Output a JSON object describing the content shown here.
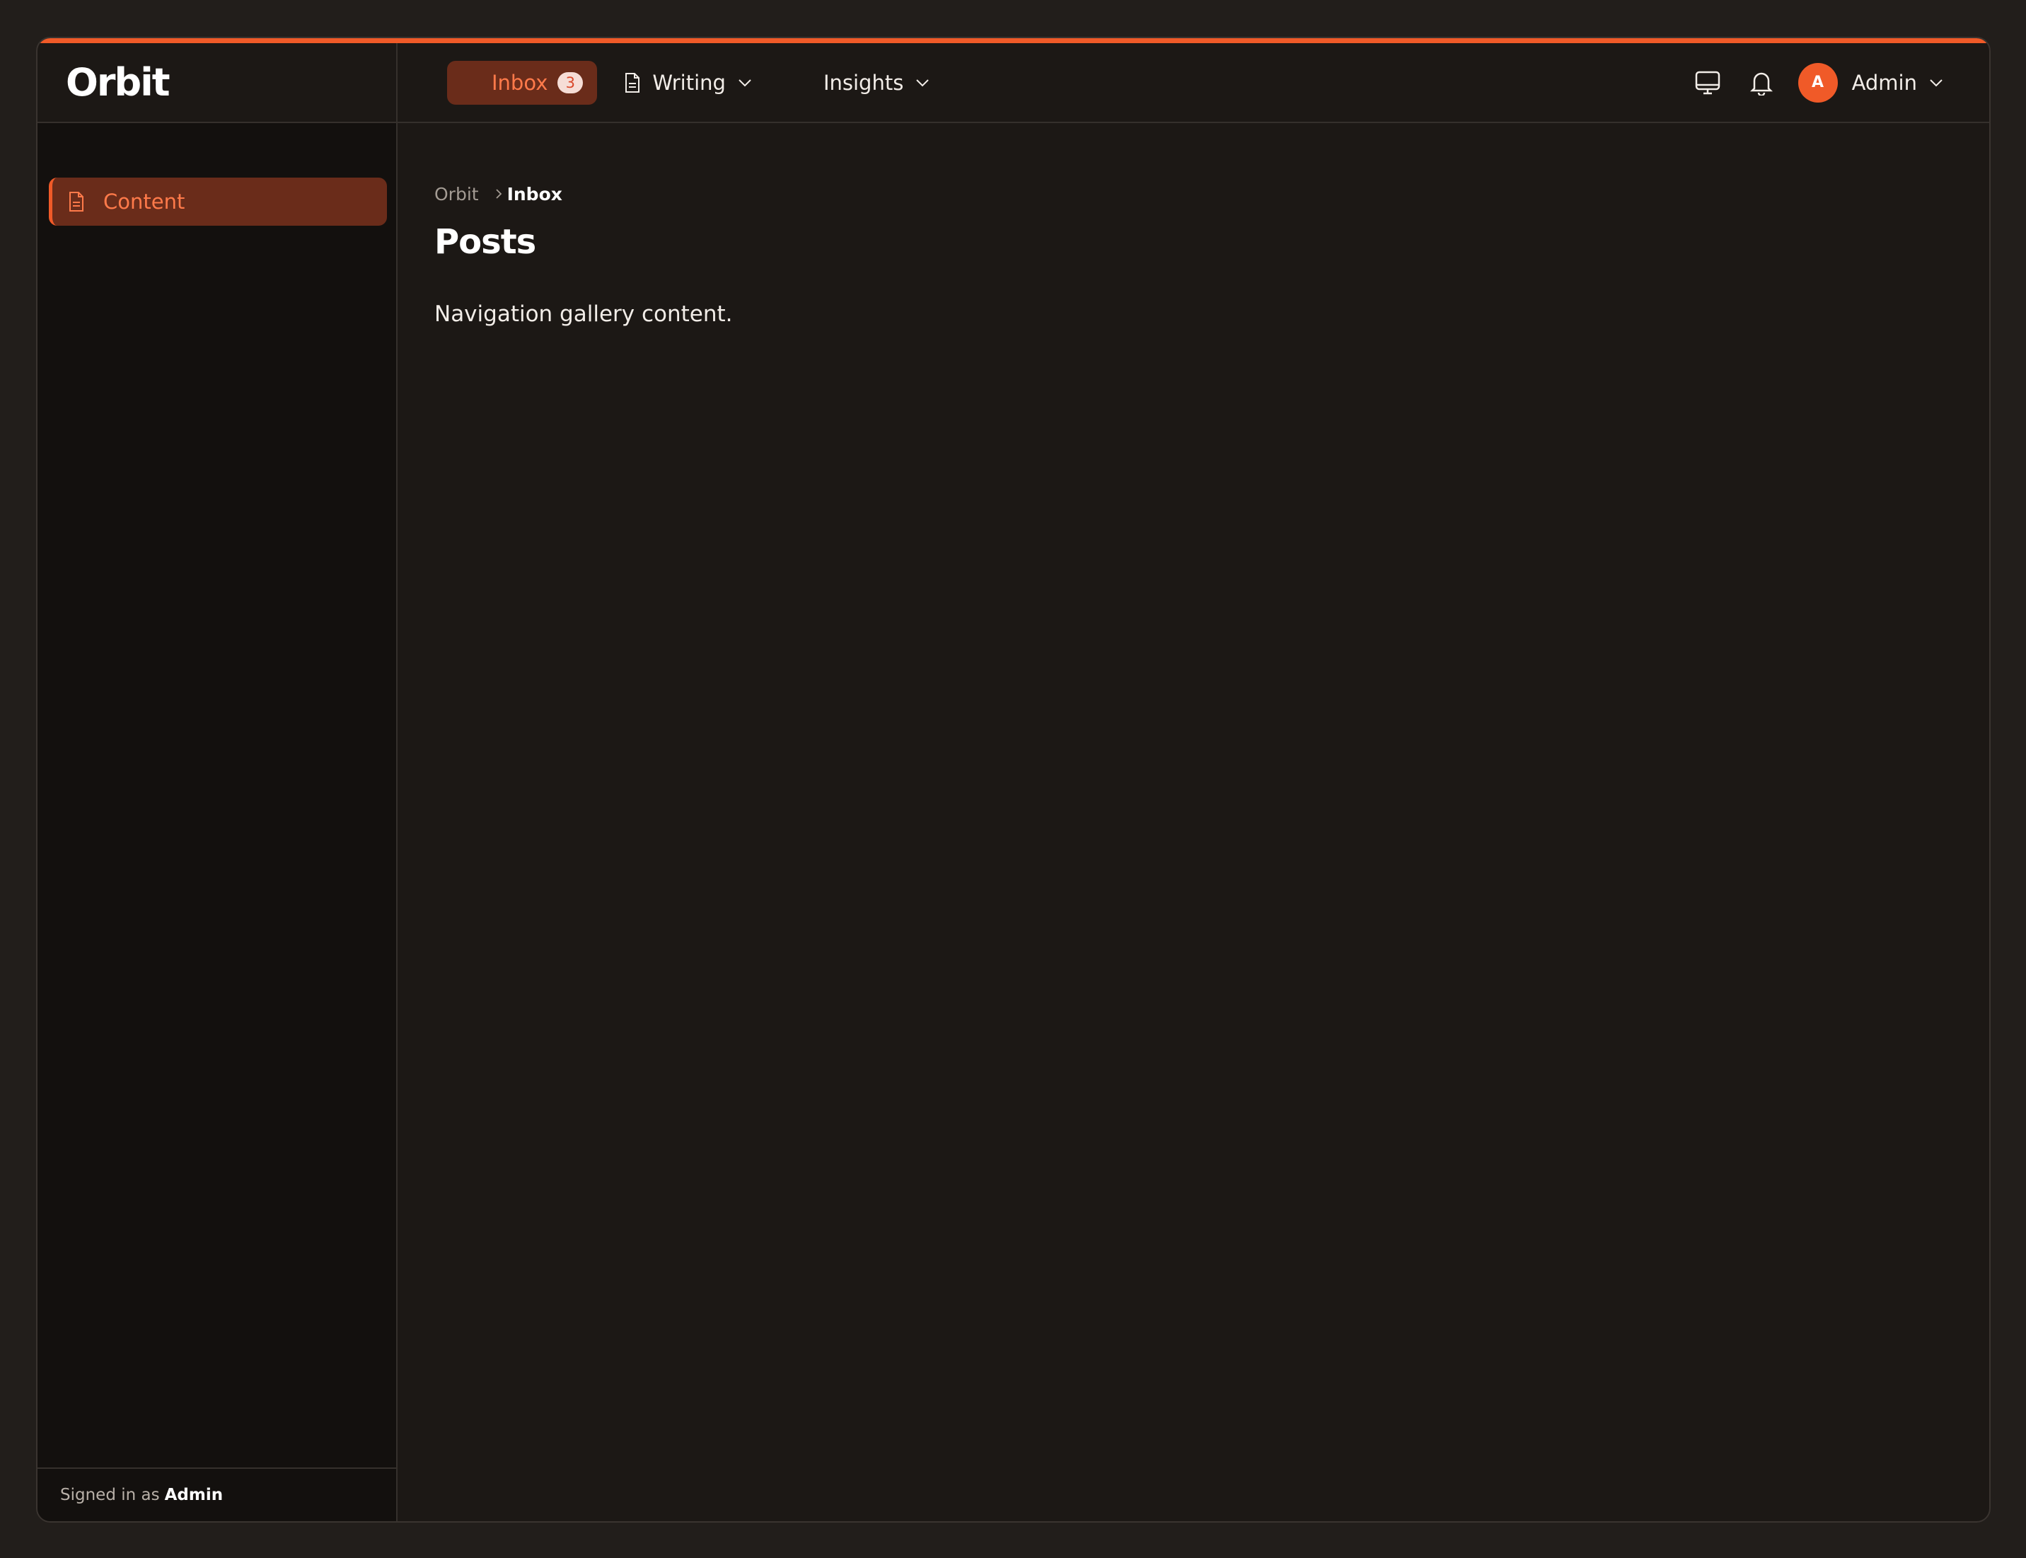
{
  "app": {
    "logo": "Orbit",
    "accent_color": "#f05a28"
  },
  "nav": {
    "items": [
      {
        "label": "Inbox",
        "badge": "3",
        "active": true
      },
      {
        "label": "Writing",
        "icon": "document-icon",
        "has_dropdown": true
      },
      {
        "label": "Insights",
        "has_dropdown": true
      }
    ]
  },
  "header": {
    "icons": [
      "monitor-icon",
      "bell-icon"
    ],
    "user": {
      "initial": "A",
      "name": "Admin"
    }
  },
  "sidebar": {
    "items": [
      {
        "label": "Content",
        "icon": "document-icon",
        "active": true
      }
    ],
    "footer": {
      "prefix": "Signed in as",
      "user": "Admin"
    }
  },
  "main": {
    "breadcrumb": [
      "Orbit",
      "Inbox"
    ],
    "title": "Posts",
    "body": "Navigation gallery content."
  }
}
